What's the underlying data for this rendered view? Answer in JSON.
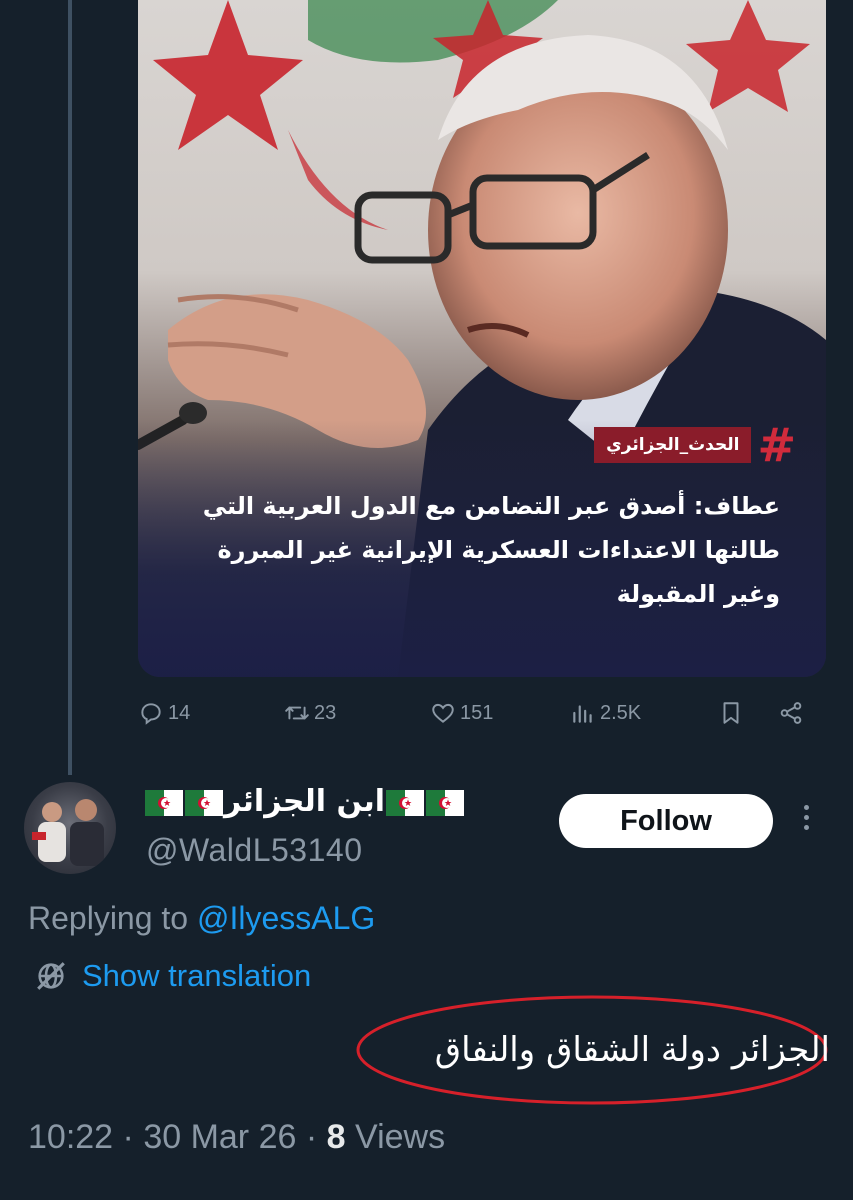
{
  "post_media": {
    "hashtag_label": "الحدث_الجزائري",
    "hashtag_symbol": "#",
    "caption": "عطاف: أصدق عبر التضامن مع الدول العربية التي طالتها الاعتداءات العسكرية الإيرانية غير المبررة وغير المقبولة"
  },
  "actions": {
    "replies": "14",
    "reposts": "23",
    "likes": "151",
    "views": "2.5K"
  },
  "reply": {
    "display_name": "ابن الجزائر",
    "handle": "@WaldL53140",
    "follow_label": "Follow",
    "replying_prefix": "Replying to ",
    "replying_to": "@IlyessALG",
    "translate_label": "Show translation",
    "text": "الجزائر دولة الشقاق والنفاق",
    "time": "10:22",
    "date": "30 Mar 26",
    "view_count": "8",
    "views_label": "Views"
  },
  "colors": {
    "background": "#15202b",
    "accent_blue": "#1d9bf0",
    "muted": "#8b98a5",
    "annotation_red": "#d6202a"
  }
}
